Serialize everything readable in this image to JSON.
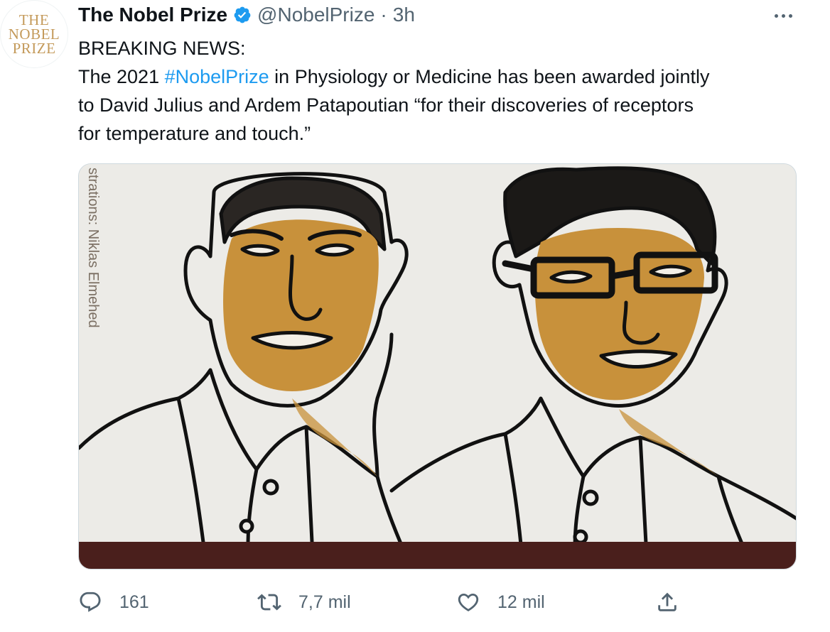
{
  "tweet": {
    "avatar_lines": [
      "THE",
      "NOBEL",
      "PRIZE"
    ],
    "display_name": "The Nobel Prize",
    "handle": "@NobelPrize",
    "separator": "·",
    "time": "3h",
    "verified_icon": "verified-badge-icon",
    "more_icon": "more-icon",
    "text": {
      "line1": "BREAKING NEWS:",
      "line2_before": "The 2021 ",
      "hashtag": "#NobelPrize",
      "line2_after": " in Physiology or Medicine has been awarded jointly",
      "line3": "to David Julius and Ardem Patapoutian “for their discoveries of receptors",
      "line4": "for temperature and touch.”"
    },
    "media": {
      "credit": "strations: Niklas Elmehed",
      "laureate_left": "David Julius",
      "laureate_right": "Ardem Patapoutian"
    },
    "actions": {
      "reply": {
        "icon": "reply-icon",
        "count": "161"
      },
      "retweet": {
        "icon": "retweet-icon",
        "count": "7,7 mil"
      },
      "like": {
        "icon": "heart-icon",
        "count": "12 mil"
      },
      "share": {
        "icon": "share-icon"
      }
    },
    "colors": {
      "accent": "#1d9bf0",
      "muted": "#536471",
      "gold": "#c9963f",
      "banner": "#4a1f1c"
    }
  }
}
